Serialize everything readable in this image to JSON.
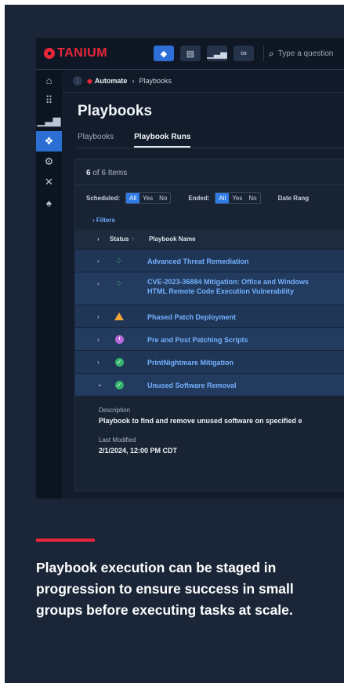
{
  "brand": {
    "name": "TANIUM",
    "color": "#e8263a"
  },
  "topbar": {
    "buttons": [
      {
        "icon": "home-gear-icon",
        "active": true
      },
      {
        "icon": "document-icon",
        "active": false
      },
      {
        "icon": "bar-chart-icon",
        "active": false
      },
      {
        "icon": "link-icon",
        "active": false
      }
    ],
    "search_placeholder": "Type a question"
  },
  "sidebar": {
    "items": [
      {
        "icon": "home-icon"
      },
      {
        "icon": "grid-icon"
      },
      {
        "icon": "chart-icon"
      },
      {
        "icon": "automate-icon",
        "active": true
      },
      {
        "icon": "gears-icon"
      },
      {
        "icon": "tools-icon"
      },
      {
        "icon": "alert-icon"
      }
    ]
  },
  "breadcrumb": {
    "module": "Automate",
    "page": "Playbooks"
  },
  "page": {
    "title": "Playbooks"
  },
  "tabs": [
    {
      "label": "Playbooks",
      "selected": false
    },
    {
      "label": "Playbook Runs",
      "selected": true
    }
  ],
  "list": {
    "count_value": "6",
    "count_text": "of 6 Items",
    "filters": {
      "scheduled_label": "Scheduled:",
      "scheduled_options": [
        "All",
        "Yes",
        "No"
      ],
      "ended_label": "Ended:",
      "ended_options": [
        "All",
        "Yes",
        "No"
      ],
      "date_range_label": "Date Rang"
    },
    "filters_link": "Filters",
    "columns": {
      "status": "Status",
      "name": "Playbook Name"
    },
    "rows": [
      {
        "name": "Advanced Threat Remediation",
        "status": "running"
      },
      {
        "name_line1": "CVE-2023-36884 Mitigation: Office and Windows",
        "name_line2": "HTML Remote Code Execution Vulnerability",
        "status": "running"
      },
      {
        "name": "Phased Patch Deployment",
        "status": "warning"
      },
      {
        "name": "Pre and Post Patching Scripts",
        "status": "scheduled"
      },
      {
        "name": "PrintNightmare Mitigation",
        "status": "completed"
      },
      {
        "name": "Unused Software Removal",
        "status": "completed",
        "expanded": true
      }
    ],
    "detail": {
      "description_label": "Description",
      "description": "Playbook to find and remove unused software on specified e",
      "last_modified_label": "Last Modified",
      "last_modified": "2/1/2024, 12:00 PM CDT"
    }
  },
  "caption": "Playbook execution can be staged in progression to ensure success in small groups before executing tasks at scale."
}
